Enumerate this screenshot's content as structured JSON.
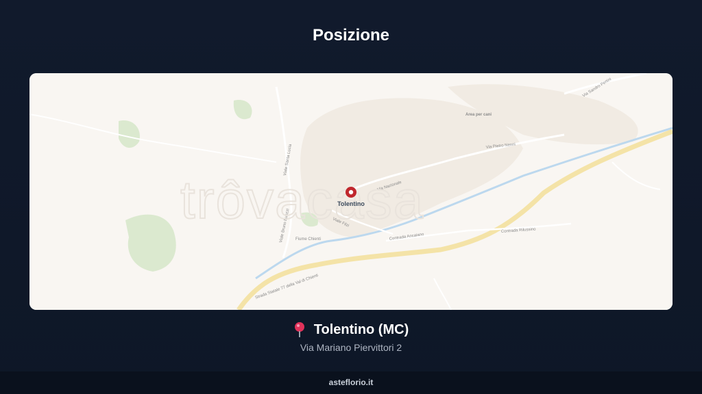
{
  "header": {
    "title": "Posizione"
  },
  "map": {
    "watermark": "trôvacasa",
    "marker_label": "Tolentino",
    "street_labels": [
      "Via Nazionale",
      "Viale Filzi",
      "Fiume Chienti",
      "Strada Statale 77 della Val di Chienti",
      "Contrada Ancaiano",
      "Viale Bruno Buozzi",
      "Viale Santa Lucia",
      "Via Pietro Nenni",
      "Via Sandro Pertini",
      "Contrada Rilussino",
      "Area per cani"
    ]
  },
  "location": {
    "icon": "map-pin-icon",
    "city": "Tolentino (MC)",
    "address": "Via Mariano Piervittori 2"
  },
  "footer": {
    "site": "asteflorio.it"
  }
}
